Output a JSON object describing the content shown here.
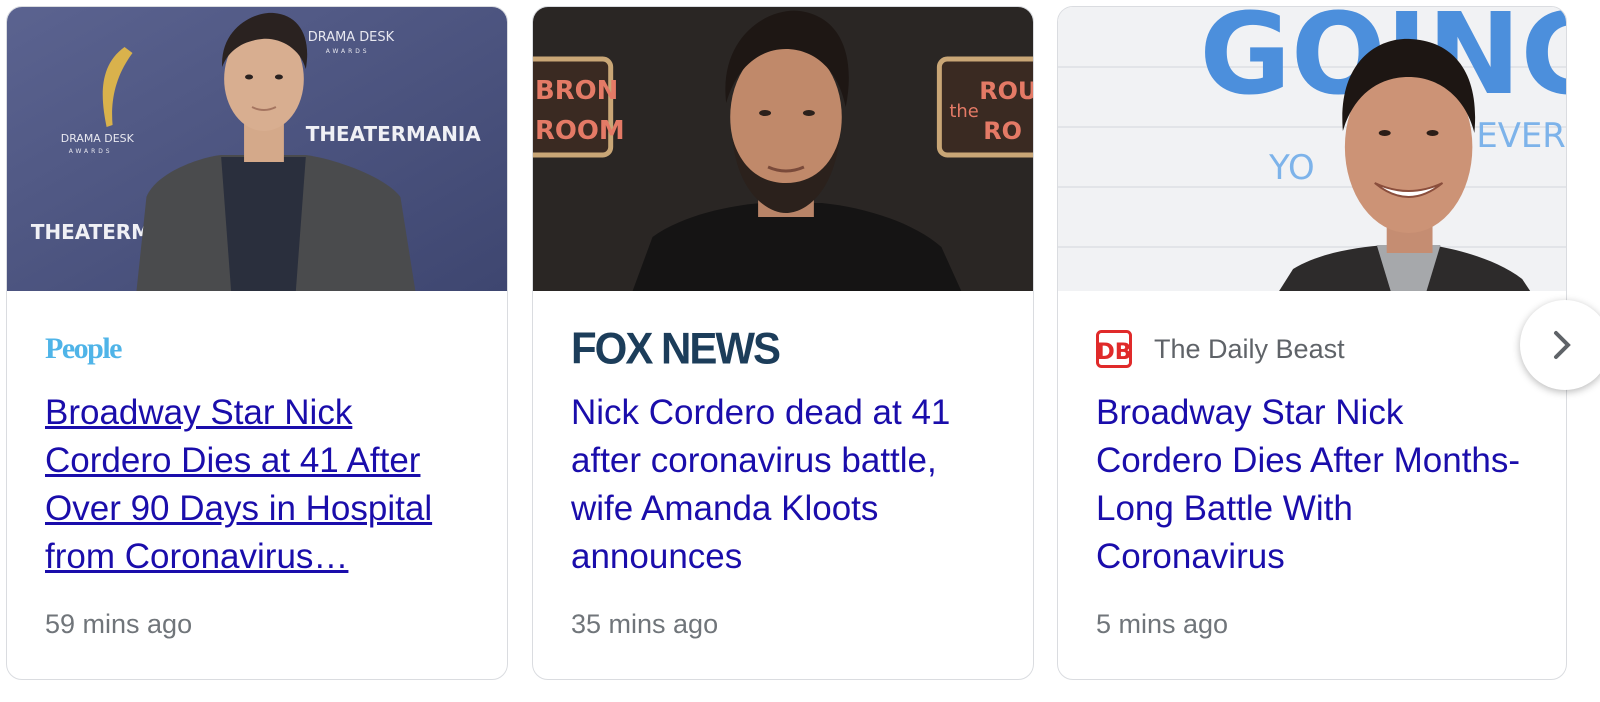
{
  "cards": [
    {
      "source": "People",
      "headline": "Broadway Star Nick Cordero Dies at 41 After Over 90 Days in Hospital from Coronavirus…",
      "time": "59 mins ago",
      "photo_backdrop_text": [
        "DRAMA DESK",
        "AWARDS",
        "DRAMA DESK",
        "AWARDS",
        "THEATERMANIA",
        "THEATERM"
      ]
    },
    {
      "source": "FOX NEWS",
      "headline": "Nick Cordero dead at 41 after coronavirus battle, wife Amanda Kloots announces",
      "time": "35 mins ago",
      "photo_backdrop_text": [
        "BRON",
        "ROOM",
        "the",
        "ROU",
        "RO"
      ]
    },
    {
      "source": "The Daily Beast",
      "source_logo": "DB",
      "headline": "Broadway Star Nick Cordero Dies After Months-Long Battle With Coronavirus",
      "time": "5 mins ago",
      "photo_backdrop_text": [
        "GOING",
        "YO",
        "EVER"
      ]
    }
  ],
  "next_icon": "chevron-right-icon",
  "colors": {
    "headline": "#1a0dab",
    "time": "#70757a",
    "people_brand": "#4fb4e8",
    "fox_brand": "#1c3d5a",
    "daily_beast_brand": "#e02a2a"
  }
}
